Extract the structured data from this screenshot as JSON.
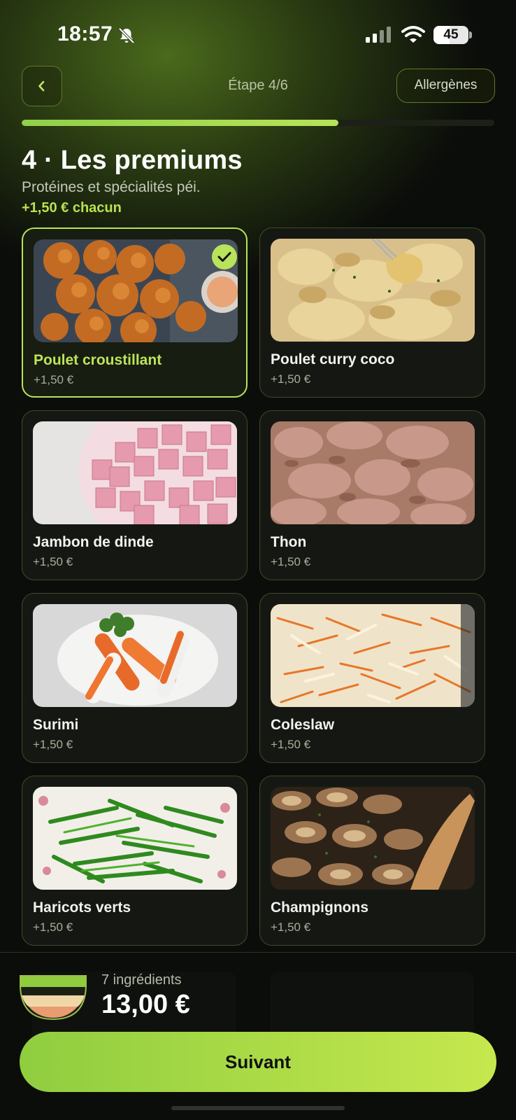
{
  "status_bar": {
    "time": "18:57",
    "battery": "45"
  },
  "header": {
    "step": "Étape 4/6",
    "allergens_label": "Allergènes",
    "progress": 0.67
  },
  "section": {
    "title": "4 · Les premiums",
    "subtitle": "Protéines et spécialités péi.",
    "price_note": "+1,50 € chacun"
  },
  "items": [
    {
      "name": "Poulet croustillant",
      "price": "+1,50 €",
      "selected": true
    },
    {
      "name": "Poulet curry coco",
      "price": "+1,50 €",
      "selected": false
    },
    {
      "name": "Jambon de dinde",
      "price": "+1,50 €",
      "selected": false
    },
    {
      "name": "Thon",
      "price": "+1,50 €",
      "selected": false
    },
    {
      "name": "Surimi",
      "price": "+1,50 €",
      "selected": false
    },
    {
      "name": "Coleslaw",
      "price": "+1,50 €",
      "selected": false
    },
    {
      "name": "Haricots verts",
      "price": "+1,50 €",
      "selected": false
    },
    {
      "name": "Champignons",
      "price": "+1,50 €",
      "selected": false
    }
  ],
  "summary": {
    "ingredients": "7 ingrédients",
    "total": "13,00 €",
    "next_label": "Suivant"
  },
  "colors": {
    "accent": "#b9e35a",
    "background": "#0b0d0a",
    "card_border": "#3f4a26"
  }
}
